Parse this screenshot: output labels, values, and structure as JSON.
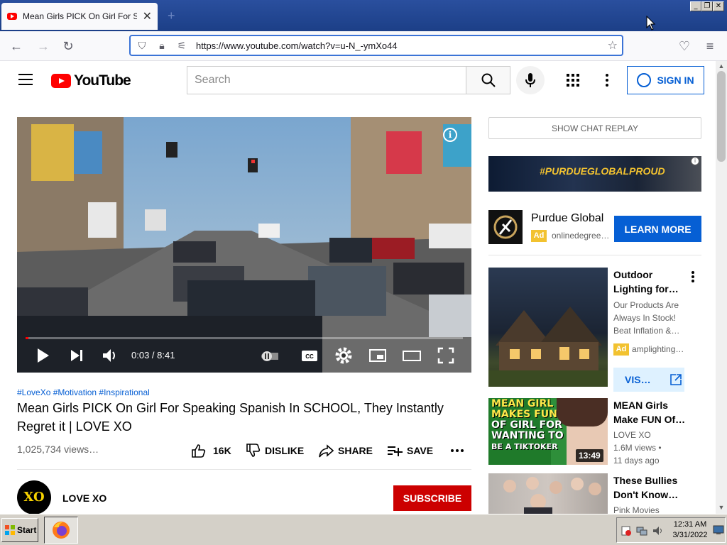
{
  "browser": {
    "tab_title": "Mean Girls PICK On Girl For Speaking Spanish In SCHOOL",
    "url": "https://www.youtube.com/watch?v=u-N_-ymXo44"
  },
  "youtube": {
    "logo_text": "YouTube",
    "search_placeholder": "Search",
    "sign_in": "SIGN IN"
  },
  "video": {
    "time": "0:03 / 8:41",
    "progress_fraction": 0.006,
    "hashtags": "#LoveXo #Motivation #Inspirational",
    "title": "Mean Girls PICK On Girl For Speaking Spanish In SCHOOL, They Instantly Regret it | LOVE XO",
    "views": "1,025,734 views…",
    "likes": "16K",
    "dislike": "DISLIKE",
    "share": "SHARE",
    "save": "SAVE",
    "channel_avatar": "XO",
    "channel": "LOVE XO",
    "subscribe": "SUBSCRIBE"
  },
  "sidebar": {
    "chat_replay": "SHOW CHAT REPLAY",
    "banner_tag": "#PURDUEGLOBALPROUD",
    "ad1": {
      "name": "Purdue Global",
      "badge": "Ad",
      "url": "onlinedegree…",
      "cta": "LEARN MORE"
    },
    "ad2": {
      "title": "Outdoor Lighting for…",
      "text": "Our Products Are Always In Stock! Beat Inflation &…",
      "badge": "Ad",
      "url": "amplighting…",
      "cta": "VIS…"
    },
    "items": [
      {
        "title": "MEAN Girls Make FUN Of…",
        "channel": "LOVE XO",
        "meta": "1.6M views •",
        "age": "11 days ago",
        "duration": "13:49",
        "thumb_text": [
          "MEAN GIRL",
          "MAKES FUN",
          "OF GIRL FOR",
          "WANTING TO",
          "BE A TIKTOKER"
        ]
      },
      {
        "title": "These Bullies Don't Know…",
        "channel": "Pink Movies"
      }
    ]
  },
  "taskbar": {
    "start": "Start",
    "time": "12:31 AM",
    "date": "3/31/2022"
  }
}
